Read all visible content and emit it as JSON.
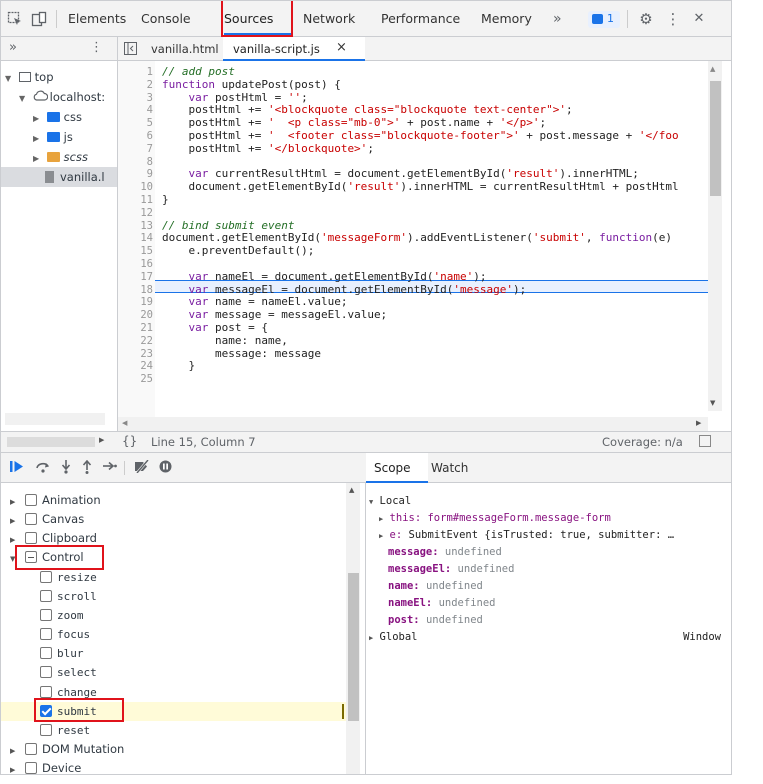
{
  "toolbar": {
    "tabs": [
      "Elements",
      "Console",
      "Sources",
      "Network",
      "Performance",
      "Memory"
    ],
    "more": "»",
    "issues_count": "1",
    "close": "✕",
    "kebab": "⋮"
  },
  "files": {
    "more": "»",
    "menu": "⋮",
    "open_tabs": [
      "vanilla.html",
      "vanilla-script.js"
    ],
    "tab_close": "×"
  },
  "navigator": {
    "items": [
      {
        "label": "top",
        "type": "frame"
      },
      {
        "label": "localhost:",
        "type": "origin"
      },
      {
        "label": "css",
        "type": "folder"
      },
      {
        "label": "js",
        "type": "folder"
      },
      {
        "label": "scss",
        "type": "folder"
      },
      {
        "label": "vanilla.l",
        "type": "file"
      }
    ]
  },
  "editor": {
    "lines": [
      {
        "n": "1",
        "code": "// add post"
      },
      {
        "n": "2",
        "code": "function updatePost(post) {"
      },
      {
        "n": "3",
        "code": "    var postHtml = '';"
      },
      {
        "n": "4",
        "code": "    postHtml += '<blockquote class=\"blockquote text-center\">';"
      },
      {
        "n": "5",
        "code": "    postHtml += '  <p class=\"mb-0\">' + post.name + '</p>';"
      },
      {
        "n": "6",
        "code": "    postHtml += '  <footer class=\"blockquote-footer\">' + post.message + '</foo"
      },
      {
        "n": "7",
        "code": "    postHtml += '</blockquote>';"
      },
      {
        "n": "8",
        "code": ""
      },
      {
        "n": "9",
        "code": "    var currentResultHtml = document.getElementById('result').innerHTML;"
      },
      {
        "n": "10",
        "code": "    document.getElementById('result').innerHTML = currentResultHtml + postHtml"
      },
      {
        "n": "11",
        "code": "}"
      },
      {
        "n": "12",
        "code": ""
      },
      {
        "n": "13",
        "code": "// bind submit event"
      },
      {
        "n": "14",
        "code": "document.getElementById('messageForm').addEventListener('submit', function(e)"
      },
      {
        "n": "15",
        "code": "    e.preventDefault();"
      },
      {
        "n": "16",
        "code": ""
      },
      {
        "n": "17",
        "code": "    var nameEl = document.getElementById('name');"
      },
      {
        "n": "18",
        "code": "    var messageEl = document.getElementById('message');"
      },
      {
        "n": "19",
        "code": "    var name = nameEl.value;"
      },
      {
        "n": "20",
        "code": "    var message = messageEl.value;"
      },
      {
        "n": "21",
        "code": "    var post = {"
      },
      {
        "n": "22",
        "code": "        name: name,"
      },
      {
        "n": "23",
        "code": "        message: message"
      },
      {
        "n": "24",
        "code": "    }"
      },
      {
        "n": "25",
        "code": ""
      }
    ]
  },
  "status": {
    "braces": "{}",
    "position": "Line 15, Column 7",
    "coverage": "Coverage: n/a"
  },
  "breakpoints": [
    {
      "label": "Animation",
      "kind": "category",
      "state": "off"
    },
    {
      "label": "Canvas",
      "kind": "category",
      "state": "off"
    },
    {
      "label": "Clipboard",
      "kind": "category",
      "state": "off"
    },
    {
      "label": "Control",
      "kind": "category",
      "state": "partial",
      "expanded": true
    },
    {
      "label": "resize",
      "kind": "event",
      "state": "off"
    },
    {
      "label": "scroll",
      "kind": "event",
      "state": "off"
    },
    {
      "label": "zoom",
      "kind": "event",
      "state": "off"
    },
    {
      "label": "focus",
      "kind": "event",
      "state": "off"
    },
    {
      "label": "blur",
      "kind": "event",
      "state": "off"
    },
    {
      "label": "select",
      "kind": "event",
      "state": "off"
    },
    {
      "label": "change",
      "kind": "event",
      "state": "off"
    },
    {
      "label": "submit",
      "kind": "event",
      "state": "on"
    },
    {
      "label": "reset",
      "kind": "event",
      "state": "off"
    },
    {
      "label": "DOM Mutation",
      "kind": "category",
      "state": "off"
    },
    {
      "label": "Device",
      "kind": "category",
      "state": "off"
    }
  ],
  "scope": {
    "tabs": [
      "Scope",
      "Watch"
    ],
    "local_label": "Local",
    "this_key": "this:",
    "this_val": "form#messageForm.message-form",
    "e_key": "e:",
    "e_val": "SubmitEvent {isTrusted: true, submitter: …",
    "vars": [
      {
        "k": "message:",
        "v": "undefined"
      },
      {
        "k": "messageEl:",
        "v": "undefined"
      },
      {
        "k": "name:",
        "v": "undefined"
      },
      {
        "k": "nameEl:",
        "v": "undefined"
      },
      {
        "k": "post:",
        "v": "undefined"
      }
    ],
    "global_label": "Global",
    "global_val": "Window"
  },
  "colors": {
    "accent": "#1a73e8",
    "highlight_box": "#e0131b",
    "paused_line": "#e8f0fe",
    "selected_breakpoint": "#fffbd8"
  }
}
